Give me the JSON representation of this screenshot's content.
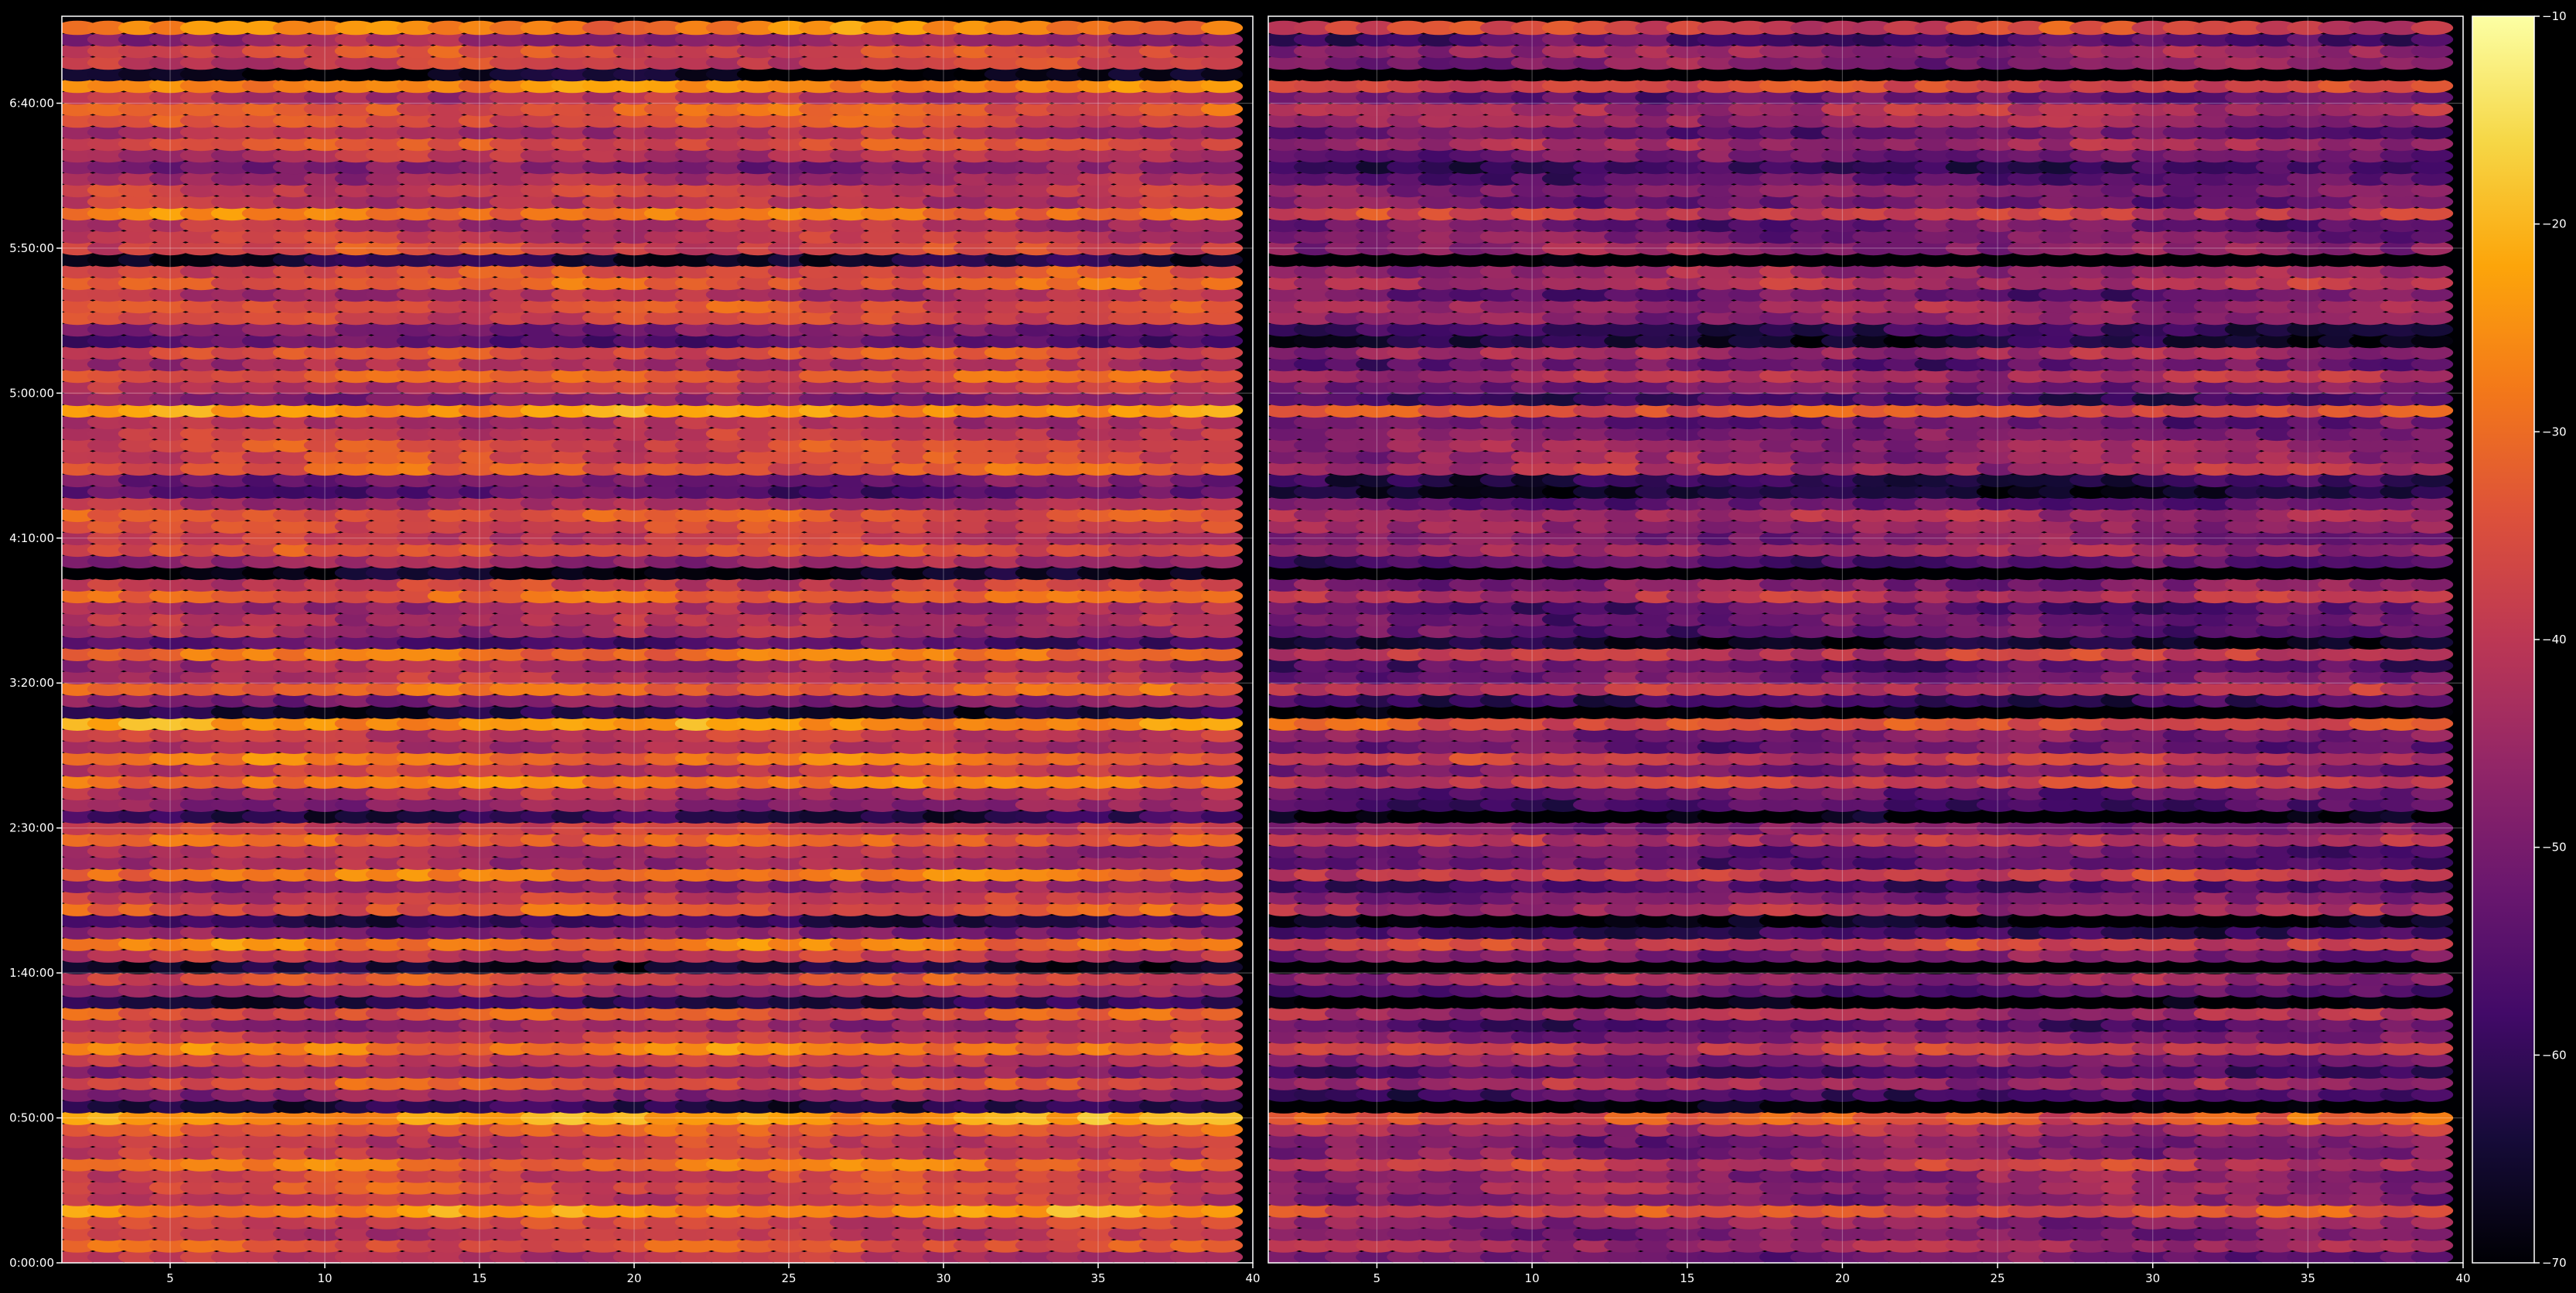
{
  "chart_data": {
    "type": "heatmap",
    "title": "",
    "xlabel": "",
    "ylabel": "",
    "background": "#000000",
    "grid": true,
    "grid_color": "#ffffff",
    "colormap": "inferno",
    "panels": [
      {
        "name": "left",
        "xlim": [
          1.5,
          40
        ],
        "x_ticks": [
          5,
          10,
          15,
          20,
          25,
          30,
          35,
          40
        ],
        "x_tick_labels": [
          "5",
          "10",
          "15",
          "20",
          "25",
          "30",
          "35",
          "40"
        ]
      },
      {
        "name": "right",
        "xlim": [
          1.5,
          40
        ],
        "x_ticks": [
          5,
          10,
          15,
          20,
          25,
          30,
          35,
          40
        ],
        "x_tick_labels": [
          "5",
          "10",
          "15",
          "20",
          "25",
          "30",
          "35",
          "40"
        ]
      }
    ],
    "y_axis": {
      "ylim_seconds": [
        0,
        25800
      ],
      "ticks_seconds": [
        0,
        3000,
        6000,
        9000,
        12000,
        15000,
        18000,
        21000,
        24000
      ],
      "tick_labels": [
        "0:00:00",
        "0:50:00",
        "1:40:00",
        "2:30:00",
        "3:20:00",
        "4:10:00",
        "5:00:00",
        "5:50:00",
        "6:40:00"
      ]
    },
    "colorbar": {
      "range": [
        -70,
        -10
      ],
      "ticks": [
        -10,
        -20,
        -30,
        -40,
        -50,
        -60,
        -70
      ],
      "tick_labels": [
        "−10",
        "−20",
        "−30",
        "−40",
        "−50",
        "−60",
        "−70"
      ]
    },
    "data_grid": {
      "x_start": 2,
      "x_end": 39.5,
      "x_step": 1,
      "y_start_seconds": 120,
      "y_end_seconds": 25740,
      "y_step_seconds": 240,
      "bright_rows_seconds": [
        420,
        1080,
        1500,
        1980,
        2700,
        3000,
        3660,
        4380,
        5100,
        5820,
        6660,
        7440,
        8040,
        8880,
        9900,
        10440,
        11160,
        11880,
        12660,
        13140,
        13920,
        14700,
        15180,
        15540,
        16320,
        16800,
        17640,
        18300,
        18960,
        19740,
        20400,
        21060,
        21660,
        22320,
        23100,
        23760,
        24360,
        25020,
        25560
      ],
      "dark_rows_seconds": [
        3300,
        5400,
        6120,
        7020,
        9240,
        11460,
        12960,
        14280,
        16080,
        19140,
        20820,
        22560,
        24600
      ],
      "note_style": "horizontal striping with rounded blob cells; right panel is the left panel shifted darker"
    }
  }
}
